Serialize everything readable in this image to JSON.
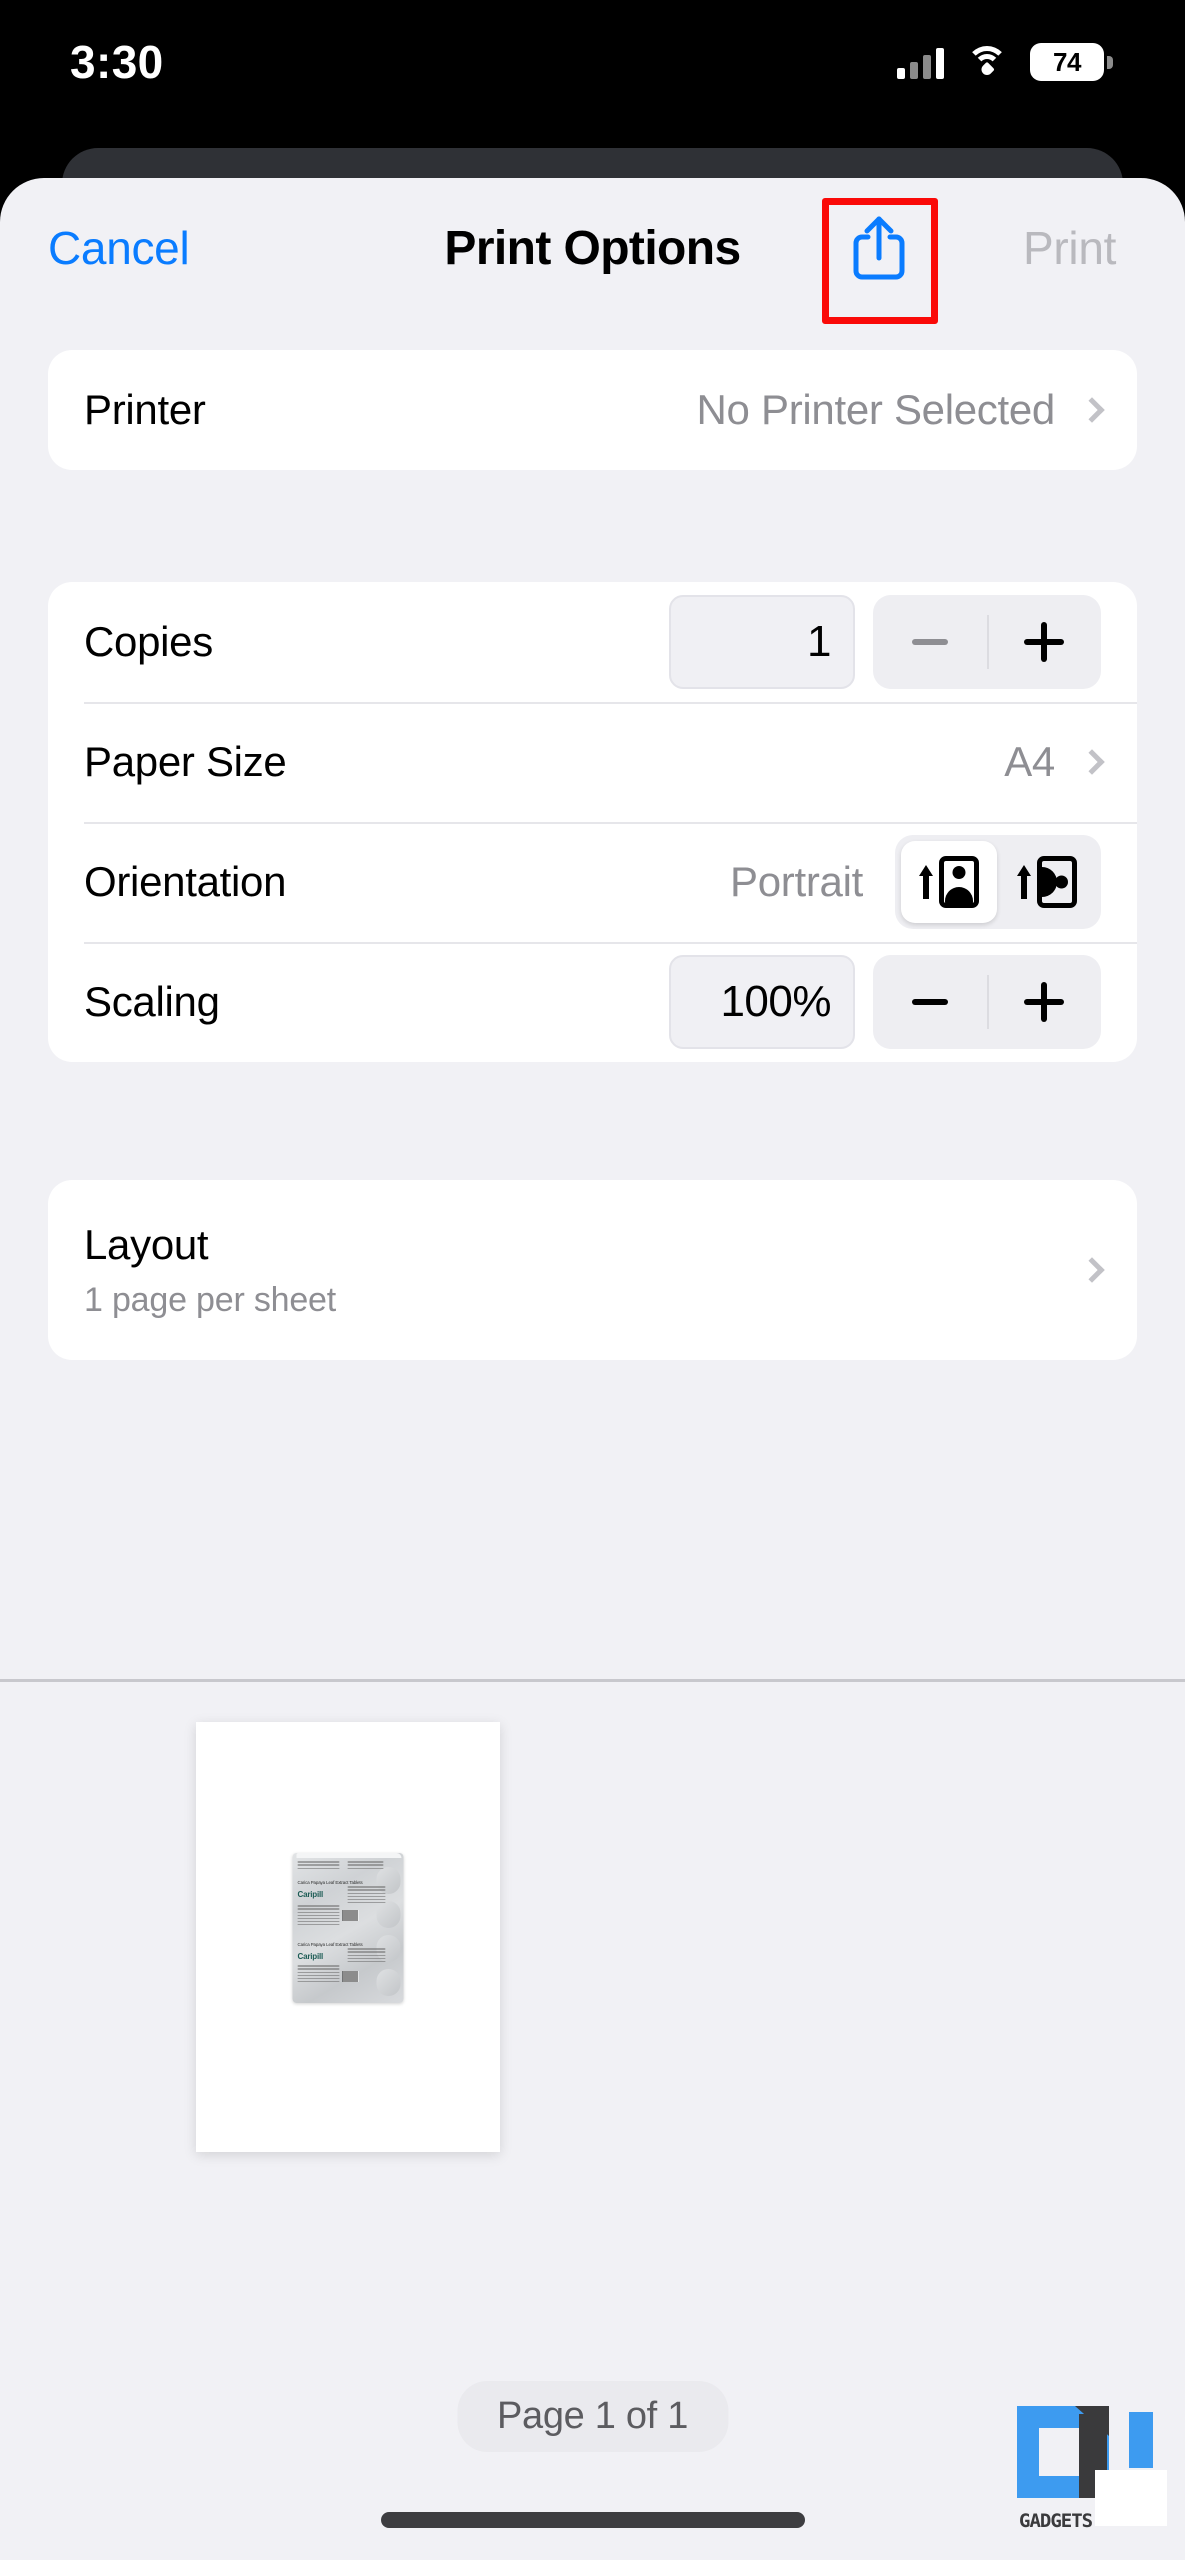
{
  "status_bar": {
    "time": "3:30",
    "battery_level": "74",
    "icons": [
      "cellular-signal-icon",
      "wifi-icon",
      "battery-icon"
    ]
  },
  "nav": {
    "cancel_label": "Cancel",
    "title": "Print Options",
    "share_icon": "share-icon",
    "print_label": "Print",
    "accent_color": "#0a7cff",
    "disabled_color": "#b9b9be",
    "highlight_color": "#fa0a08"
  },
  "printer_section": {
    "label": "Printer",
    "value": "No Printer Selected"
  },
  "options_section": {
    "copies": {
      "label": "Copies",
      "value": "1",
      "decrement_label": "−",
      "increment_label": "+",
      "decrement_enabled": false
    },
    "paper_size": {
      "label": "Paper Size",
      "value": "A4"
    },
    "orientation": {
      "label": "Orientation",
      "value": "Portrait",
      "portrait_icon": "orientation-portrait-icon",
      "landscape_icon": "orientation-landscape-icon",
      "selected": "portrait"
    },
    "scaling": {
      "label": "Scaling",
      "value": "100%",
      "decrement_label": "−",
      "increment_label": "+",
      "decrement_enabled": true
    }
  },
  "layout_section": {
    "label": "Layout",
    "sublabel": "1 page per sheet"
  },
  "preview": {
    "page_indicator": "Page 1 of 1",
    "document_lines": {
      "product_line": "Carica Papaya Leaf Extract Tablets",
      "brand": "Caripill"
    }
  },
  "watermark": {
    "text": "GADGETS"
  }
}
